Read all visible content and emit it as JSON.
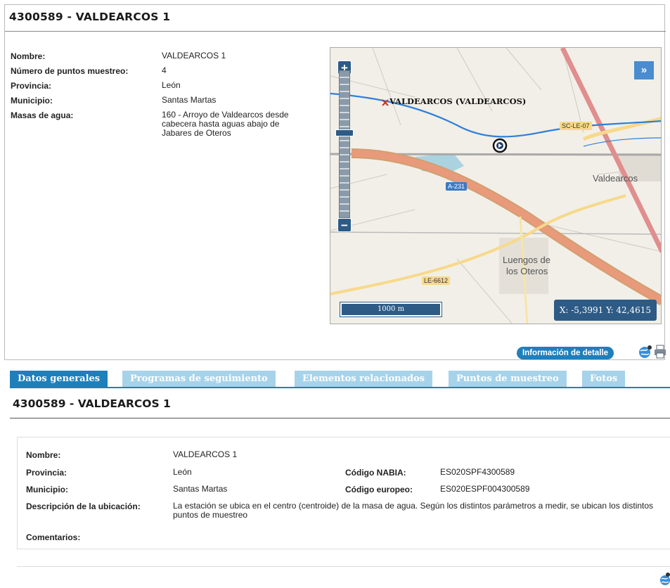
{
  "station": {
    "title": "4300589 - VALDEARCOS 1"
  },
  "summary": [
    {
      "label": "Nombre:",
      "value": "VALDEARCOS 1"
    },
    {
      "label": "Número de puntos muestreo:",
      "value": "4"
    },
    {
      "label": "Provincia:",
      "value": "León"
    },
    {
      "label": "Municipio:",
      "value": "Santas Martas"
    },
    {
      "label": "Masas de agua:",
      "value": "160 - Arroyo de Valdearcos desde cabecera hasta aguas abajo de Jabares de Oteros"
    }
  ],
  "map": {
    "zoom_in": "+",
    "zoom_out": "−",
    "expand": "»",
    "station_label": "VALDEARCOS (VALDEARCOS)",
    "places": [
      "Valdearcos",
      "Luengos de",
      "los Oteros"
    ],
    "roads": [
      "SC-LE-07",
      "A-231",
      "LE-6612"
    ],
    "scale": "1000 m",
    "coords": "X: -5,3991 Y: 42,4615",
    "icons": {
      "marker": "station-marker-icon",
      "point": "sampling-point-icon"
    }
  },
  "actions": {
    "detail_button": "Información de detalle",
    "icons": [
      "globe-icon",
      "print-icon"
    ]
  },
  "tabs": [
    {
      "label": "Datos generales",
      "active": true
    },
    {
      "label": "Programas de seguimiento",
      "active": false
    },
    {
      "label": "Elementos relacionados",
      "active": false
    },
    {
      "label": "Puntos de muestreo",
      "active": false
    },
    {
      "label": "Fotos",
      "active": false
    }
  ],
  "details": {
    "title": "4300589 - VALDEARCOS 1",
    "nombre_label": "Nombre:",
    "nombre": "VALDEARCOS 1",
    "provincia_label": "Provincia:",
    "provincia": "León",
    "municipio_label": "Municipio:",
    "municipio": "Santas Martas",
    "nabia_label": "Código NABIA:",
    "nabia": "ES020SPF4300589",
    "europeo_label": "Código europeo:",
    "europeo": "ES020ESPF004300589",
    "descripcion_label": "Descripción de la ubicación:",
    "descripcion": "La estación se ubica en el centro (centroide) de la masa de agua. Según los distintos parámetros a medir, se ubican los distintos puntos de muestreo",
    "comentarios_label": "Comentarios:",
    "comentarios": ""
  },
  "colors": {
    "accent": "#1f7fba",
    "tab_inactive": "#a6d3ea",
    "map_control": "#2d5b86",
    "river": "#2f7fd8",
    "road_motorway": "#e88a7a"
  }
}
